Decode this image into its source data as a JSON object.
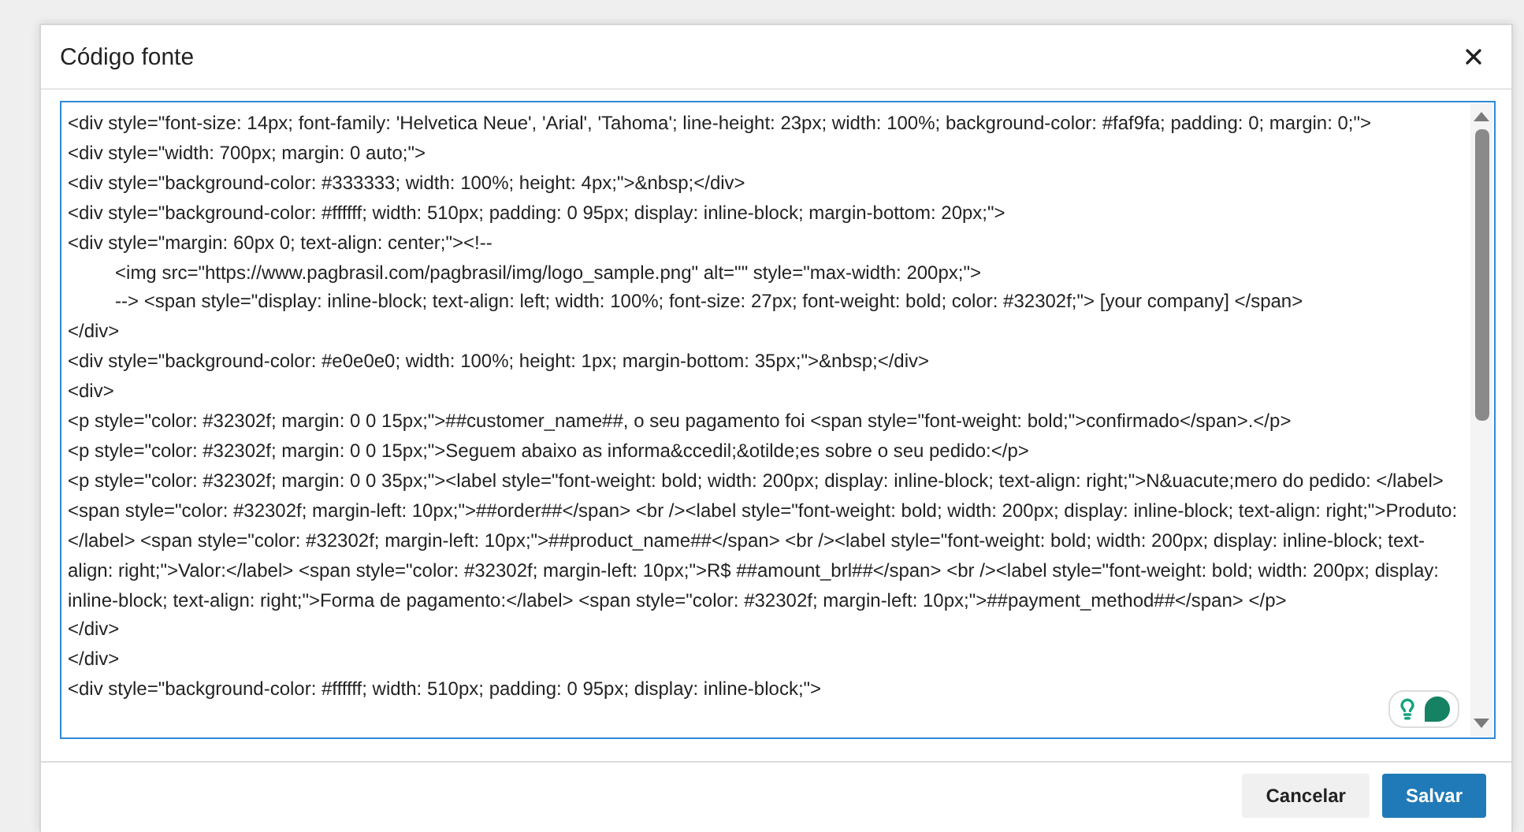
{
  "dialog": {
    "title": "Código fonte",
    "code_editor": {
      "lines": [
        "<div style=\"font-size: 14px; font-family: 'Helvetica Neue', 'Arial', 'Tahoma'; line-height: 23px; width: 100%; background-color: #faf9fa; padding: 0; margin: 0;\">",
        "<div style=\"width: 700px; margin: 0 auto;\">",
        "<div style=\"background-color: #333333; width: 100%; height: 4px;\">&nbsp;</div>",
        "<div style=\"background-color: #ffffff; width: 510px; padding: 0 95px; display: inline-block; margin-bottom: 20px;\">",
        "<div style=\"margin: 60px 0; text-align: center;\"><!--",
        "\t<img src=\"https://www.pagbrasil.com/pagbrasil/img/logo_sample.png\" alt=\"\" style=\"max-width: 200px;\">",
        "\t--> <span style=\"display: inline-block; text-align: left; width: 100%; font-size: 27px; font-weight: bold; color: #32302f;\"> [your company] </span>",
        "</div>",
        "<div style=\"background-color: #e0e0e0; width: 100%; height: 1px; margin-bottom: 35px;\">&nbsp;</div>",
        "<div>",
        "<p style=\"color: #32302f; margin: 0 0 15px;\">##customer_name##, o seu pagamento foi <span style=\"font-weight: bold;\">confirmado</span>.</p>",
        "<p style=\"color: #32302f; margin: 0 0 15px;\">Seguem abaixo as informa&ccedil;&otilde;es sobre o seu pedido:</p>",
        "<p style=\"color: #32302f; margin: 0 0 35px;\"><label style=\"font-weight: bold; width: 200px; display: inline-block; text-align: right;\">N&uacute;mero do pedido: </label> <span style=\"color: #32302f; margin-left: 10px;\">##order##</span> <br /><label style=\"font-weight: bold; width: 200px; display: inline-block; text-align: right;\">Produto:</label> <span style=\"color: #32302f; margin-left: 10px;\">##product_name##</span> <br /><label style=\"font-weight: bold; width: 200px; display: inline-block; text-align: right;\">Valor:</label> <span style=\"color: #32302f; margin-left: 10px;\">R$ ##amount_brl##</span> <br /><label style=\"font-weight: bold; width: 200px; display: inline-block; text-align: right;\">Forma de pagamento:</label> <span style=\"color: #32302f; margin-left: 10px;\">##payment_method##</span> </p>",
        "</div>",
        "</div>",
        "<div style=\"background-color: #ffffff; width: 510px; padding: 0 95px; display: inline-block;\">"
      ]
    },
    "buttons": [
      {
        "label": "Cancelar",
        "kind": "secondary"
      },
      {
        "label": "Salvar",
        "kind": "primary"
      }
    ]
  }
}
